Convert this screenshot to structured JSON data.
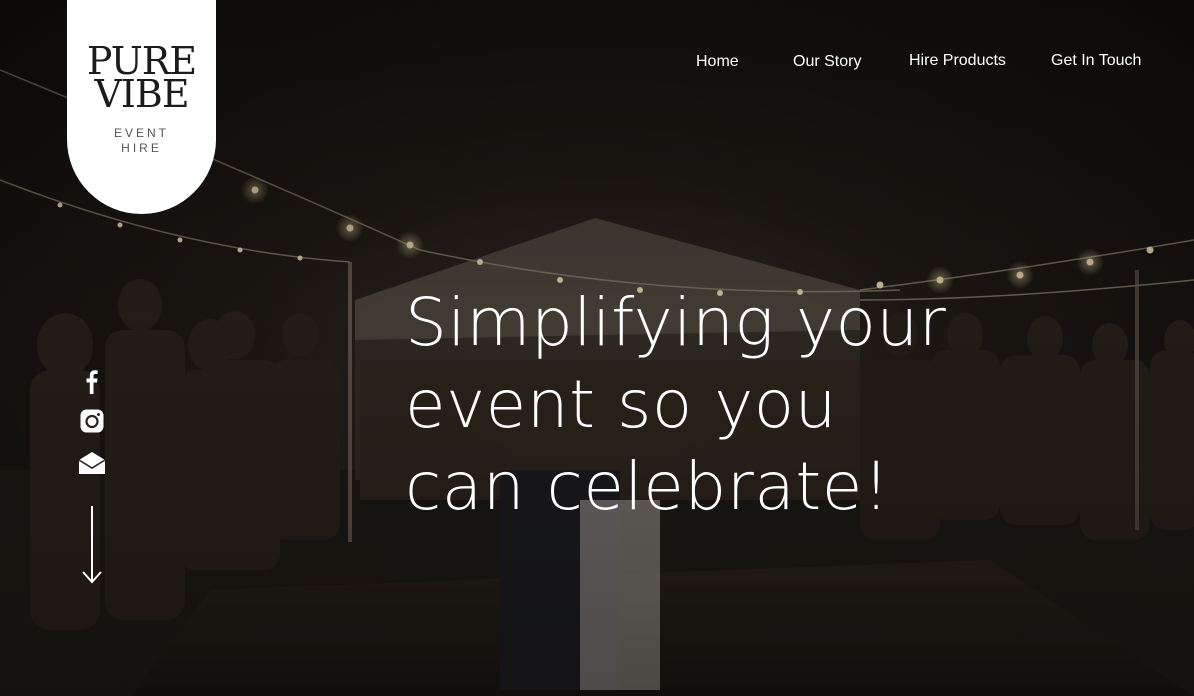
{
  "logo": {
    "line1": "PURE",
    "line2": "VIBE",
    "sub1": "EVENT",
    "sub2": "HIRE"
  },
  "nav": {
    "items": [
      {
        "label": "Home"
      },
      {
        "label": "Our Story"
      },
      {
        "label": "Hire Products"
      },
      {
        "label": "Get In Touch"
      }
    ]
  },
  "hero": {
    "headline_lines": [
      "Simplifying your",
      "event so you",
      "can celebrate!"
    ]
  },
  "social": {
    "icons": [
      "facebook-icon",
      "instagram-icon",
      "mail-icon"
    ],
    "scroll_icon": "arrow-down-icon"
  },
  "colors": {
    "text": "#ffffff",
    "badge": "#ffffff",
    "logo_text": "#1c1c1c"
  }
}
